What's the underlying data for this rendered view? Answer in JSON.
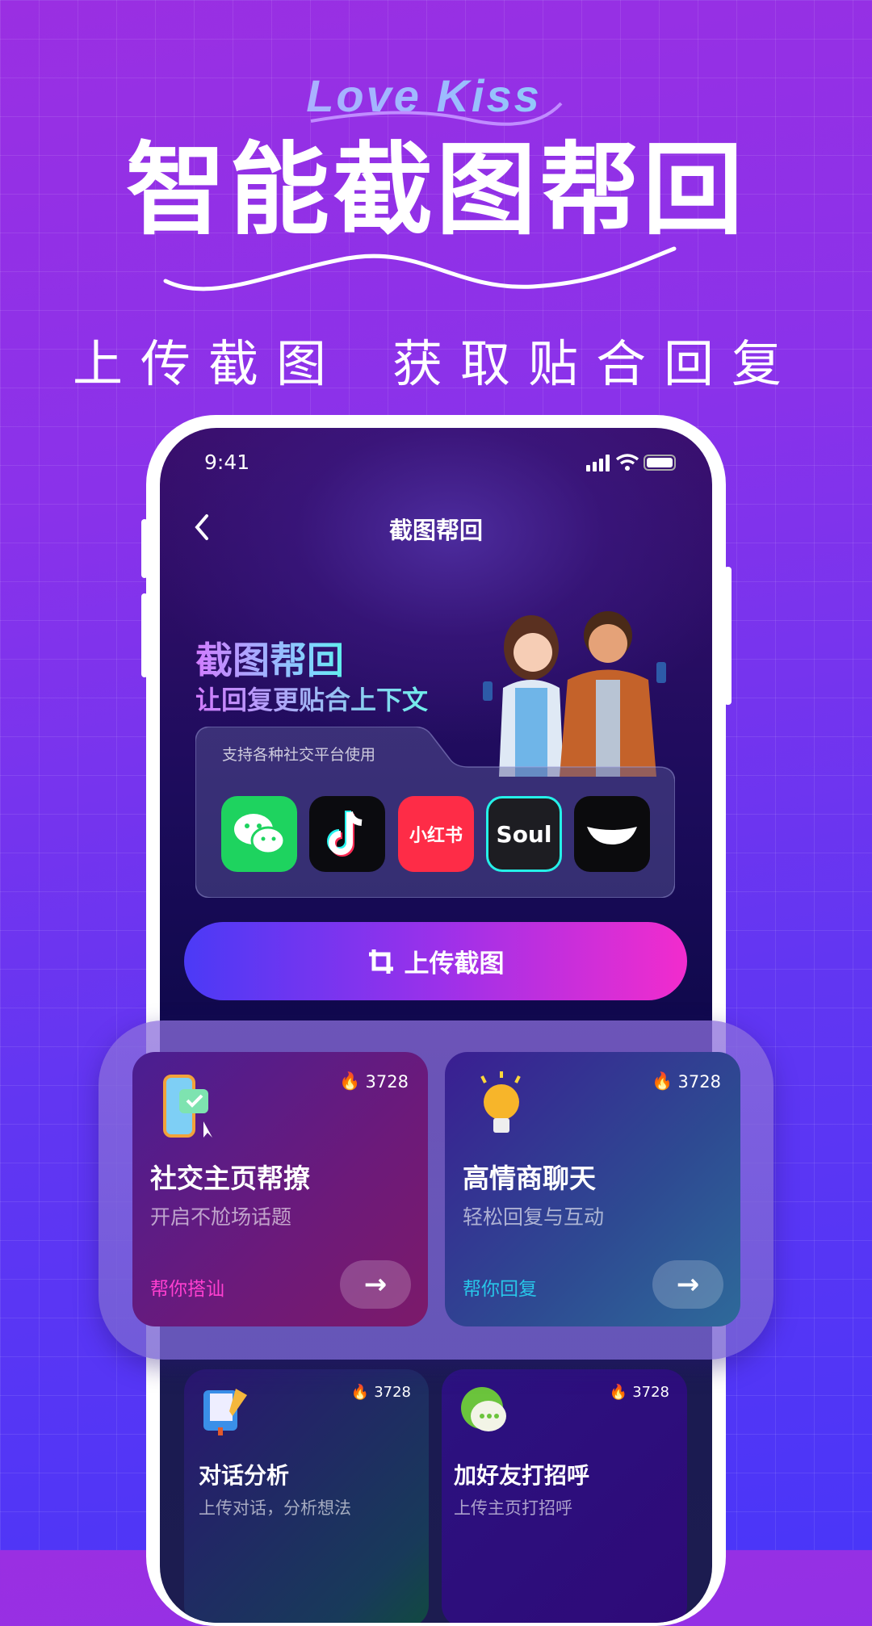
{
  "brand": {
    "logo": "Love Kiss",
    "headline": "智能截图帮回",
    "tagline_left": "上传截图",
    "tagline_right": "获取贴合回复"
  },
  "phone": {
    "status_time": "9:41",
    "nav_title": "截图帮回",
    "hero_title": "截图帮回",
    "hero_subtitle": "让回复更贴合上下文",
    "platform_label": "支持各种社交平台使用",
    "platforms": [
      {
        "name": "WeChat",
        "icon": "wechat-icon",
        "color": "#1ed35f"
      },
      {
        "name": "TikTok",
        "icon": "tiktok-icon",
        "color": "#0b0b0f"
      },
      {
        "name": "小红书",
        "icon": "xiaohongshu-icon",
        "color": "#fe2c47"
      },
      {
        "name": "Soul",
        "icon": "soul-icon",
        "color": "#1d1d22"
      },
      {
        "name": "Momo",
        "icon": "momo-icon",
        "color": "#0b0b0d"
      }
    ],
    "upload_label": "上传截图"
  },
  "cards": [
    {
      "title": "社交主页帮撩",
      "subtitle": "开启不尬场话题",
      "link": "帮你搭讪",
      "count": "3728",
      "link_color": "#ff3fd0",
      "icon": "phone-chat-icon"
    },
    {
      "title": "高情商聊天",
      "subtitle": "轻松回复与互动",
      "link": "帮你回复",
      "count": "3728",
      "link_color": "#28c6e8",
      "icon": "lightbulb-icon"
    },
    {
      "title": "对话分析",
      "subtitle": "上传对话，分析想法",
      "count": "3728",
      "icon": "notebook-icon"
    },
    {
      "title": "加好友打招呼",
      "subtitle": "上传主页打招呼",
      "count": "3728",
      "icon": "chat-bubble-icon"
    }
  ]
}
